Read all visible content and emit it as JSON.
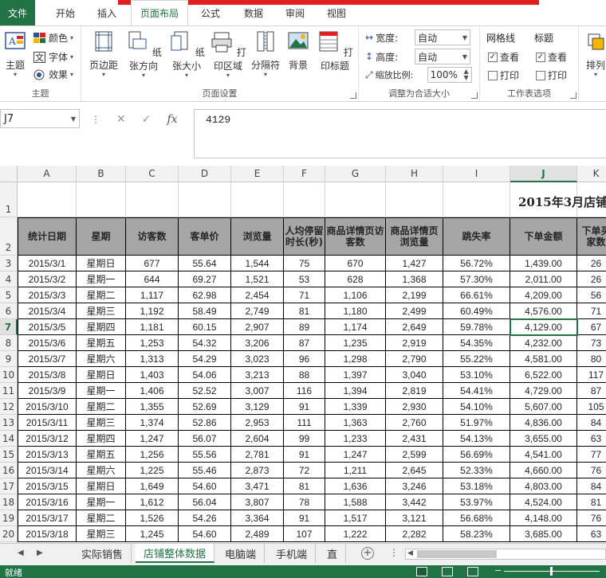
{
  "ribbon_tabs": [
    {
      "label": "文件"
    },
    {
      "label": "开始"
    },
    {
      "label": "插入"
    },
    {
      "label": "页面布局"
    },
    {
      "label": "公式"
    },
    {
      "label": "数据"
    },
    {
      "label": "审阅"
    },
    {
      "label": "视图"
    }
  ],
  "ribbon": {
    "theme_group": {
      "themes": "主题",
      "colors": "颜色",
      "fonts": "字体",
      "effects": "效果",
      "label": "主题"
    },
    "page_setup": {
      "margins": "页边距",
      "orientation": "纸张方向",
      "size": "纸张大小",
      "print_area": "打印区域",
      "breaks": "分隔符",
      "background": "背景",
      "print_titles": "打印标题",
      "label": "页面设置"
    },
    "scale": {
      "width_label": "宽度:",
      "width_value": "自动",
      "height_label": "高度:",
      "height_value": "自动",
      "scale_label": "缩放比例:",
      "scale_value": "100%",
      "label": "调整为合适大小"
    },
    "sheet_options": {
      "gridlines": "网格线",
      "headings": "标题",
      "view": "查看",
      "print": "打印",
      "label": "工作表选项"
    },
    "arrange": "排列"
  },
  "formula_bar": {
    "name_box": "J7",
    "formula": "4129"
  },
  "columns": [
    "A",
    "B",
    "C",
    "D",
    "E",
    "F",
    "G",
    "H",
    "I",
    "J",
    "K"
  ],
  "sheet": {
    "title": "2015年3月店铺",
    "headers": [
      "统计日期",
      "星期",
      "访客数",
      "客单价",
      "浏览量",
      "人均停留时长(秒)",
      "商品详情页访客数",
      "商品详情页浏览量",
      "跳失率",
      "下单金额",
      "下单买家数"
    ],
    "rows": [
      [
        "2015/3/1",
        "星期日",
        "677",
        "55.64",
        "1,544",
        "75",
        "670",
        "1,427",
        "56.72%",
        "1,439.00",
        "26"
      ],
      [
        "2015/3/2",
        "星期一",
        "644",
        "69.27",
        "1,521",
        "53",
        "628",
        "1,368",
        "57.30%",
        "2,011.00",
        "26"
      ],
      [
        "2015/3/3",
        "星期二",
        "1,117",
        "62.98",
        "2,454",
        "71",
        "1,106",
        "2,199",
        "66.61%",
        "4,209.00",
        "56"
      ],
      [
        "2015/3/4",
        "星期三",
        "1,192",
        "58.49",
        "2,749",
        "81",
        "1,180",
        "2,499",
        "60.49%",
        "4,576.00",
        "71"
      ],
      [
        "2015/3/5",
        "星期四",
        "1,181",
        "60.15",
        "2,907",
        "89",
        "1,174",
        "2,649",
        "59.78%",
        "4,129.00",
        "67"
      ],
      [
        "2015/3/6",
        "星期五",
        "1,253",
        "54.32",
        "3,206",
        "87",
        "1,235",
        "2,919",
        "54.35%",
        "4,232.00",
        "73"
      ],
      [
        "2015/3/7",
        "星期六",
        "1,313",
        "54.29",
        "3,023",
        "96",
        "1,298",
        "2,790",
        "55.22%",
        "4,581.00",
        "80"
      ],
      [
        "2015/3/8",
        "星期日",
        "1,403",
        "54.06",
        "3,213",
        "88",
        "1,397",
        "3,040",
        "53.10%",
        "6,522.00",
        "117"
      ],
      [
        "2015/3/9",
        "星期一",
        "1,406",
        "52.52",
        "3,007",
        "116",
        "1,394",
        "2,819",
        "54.41%",
        "4,729.00",
        "87"
      ],
      [
        "2015/3/10",
        "星期二",
        "1,355",
        "52.69",
        "3,129",
        "91",
        "1,339",
        "2,930",
        "54.10%",
        "5,607.00",
        "105"
      ],
      [
        "2015/3/11",
        "星期三",
        "1,374",
        "52.86",
        "2,953",
        "111",
        "1,363",
        "2,760",
        "51.97%",
        "4,836.00",
        "84"
      ],
      [
        "2015/3/12",
        "星期四",
        "1,247",
        "56.07",
        "2,604",
        "99",
        "1,233",
        "2,431",
        "54.13%",
        "3,655.00",
        "63"
      ],
      [
        "2015/3/13",
        "星期五",
        "1,256",
        "55.56",
        "2,781",
        "91",
        "1,247",
        "2,599",
        "56.69%",
        "4,541.00",
        "77"
      ],
      [
        "2015/3/14",
        "星期六",
        "1,225",
        "55.46",
        "2,873",
        "72",
        "1,211",
        "2,645",
        "52.33%",
        "4,660.00",
        "76"
      ],
      [
        "2015/3/15",
        "星期日",
        "1,649",
        "54.60",
        "3,471",
        "81",
        "1,636",
        "3,246",
        "53.18%",
        "4,803.00",
        "84"
      ],
      [
        "2015/3/16",
        "星期一",
        "1,612",
        "56.04",
        "3,807",
        "78",
        "1,588",
        "3,442",
        "53.97%",
        "4,524.00",
        "81"
      ],
      [
        "2015/3/17",
        "星期二",
        "1,526",
        "54.26",
        "3,364",
        "91",
        "1,517",
        "3,121",
        "56.68%",
        "4,148.00",
        "76"
      ],
      [
        "2015/3/18",
        "星期三",
        "1,245",
        "54.60",
        "2,489",
        "107",
        "1,222",
        "2,282",
        "58.23%",
        "3,685.00",
        "63"
      ]
    ]
  },
  "sheet_tabs": [
    {
      "label": "实际销售"
    },
    {
      "label": "店铺整体数据"
    },
    {
      "label": "电脑端"
    },
    {
      "label": "手机端"
    },
    {
      "label": "直"
    }
  ],
  "status_bar": {
    "ready": "就绪"
  },
  "colors": {
    "excel_green": "#217346",
    "header_fill": "#a6a6a6",
    "red_bar": "#e32020"
  }
}
